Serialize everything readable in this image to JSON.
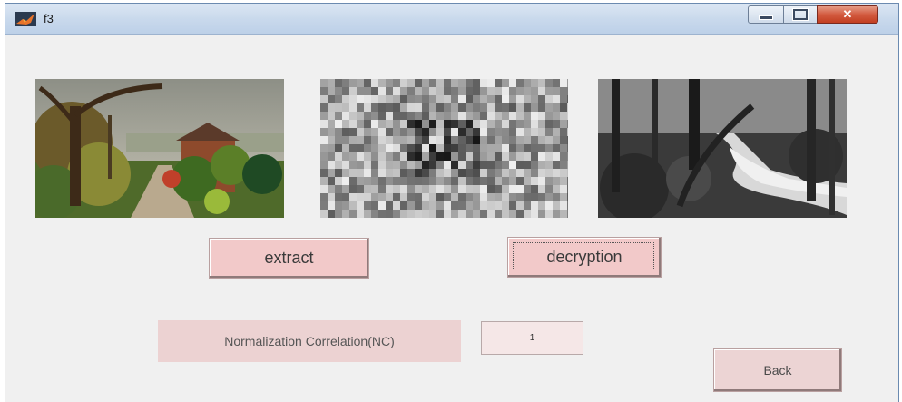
{
  "window": {
    "title": "f3"
  },
  "icons": {
    "app": "matlab-icon",
    "minimize": "minimize-icon",
    "maximize": "maximize-icon",
    "close": "close-icon"
  },
  "images": [
    {
      "name": "original-color-image",
      "description_name": "village-lane-photo"
    },
    {
      "name": "encrypted-image",
      "description_name": "scrambled-blocks-image"
    },
    {
      "name": "decrypted-grayscale-image",
      "description_name": "forest-stream-photo"
    }
  ],
  "buttons": {
    "extract": "extract",
    "decryption": "decryption",
    "back": "Back"
  },
  "nc": {
    "label": "Normalization Correlation(NC)",
    "value": "1"
  },
  "colors": {
    "button_bg": "#f2c9c9",
    "label_bg": "#ecd2d2",
    "window_bg": "#f0f0f0",
    "close_red": "#c23e21"
  }
}
